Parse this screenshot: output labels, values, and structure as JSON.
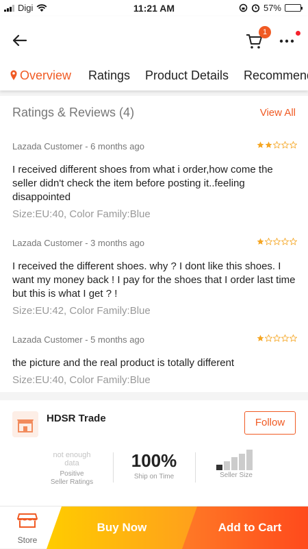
{
  "status_bar": {
    "carrier": "Digi",
    "time": "11:21 AM",
    "battery": "57%",
    "battery_level": 0.57
  },
  "header": {
    "cart_count": "1",
    "icons": [
      "back-arrow-icon",
      "cart-icon",
      "more-icon"
    ]
  },
  "tabs": [
    {
      "label": "Overview",
      "active": true
    },
    {
      "label": "Ratings",
      "active": false
    },
    {
      "label": "Product Details",
      "active": false
    },
    {
      "label": "Recommend",
      "active": false
    }
  ],
  "reviews_section": {
    "title": "Ratings & Reviews (4)",
    "view_all": "View All",
    "reviews": [
      {
        "meta": "Lazada Customer - 6 months ago",
        "rating": 2,
        "body": "I received different shoes from what i order,how come the seller didn't check the item before posting it..feeling disappointed",
        "sku": "Size:EU:40, Color Family:Blue"
      },
      {
        "meta": "Lazada Customer - 3 months ago",
        "rating": 1,
        "body": "I received the different shoes. why ? I dont like this shoes. I want my money back ! I pay for the shoes that I order last time but this is what I get ? !",
        "sku": "Size:EU:42, Color Family:Blue"
      },
      {
        "meta": "Lazada Customer - 5 months ago",
        "rating": 1,
        "body": "the picture and the real product is totally different",
        "sku": "Size:EU:40, Color Family:Blue"
      }
    ]
  },
  "store": {
    "name": "HDSR Trade",
    "follow": "Follow",
    "metrics": {
      "ratings_value_1": "not enough",
      "ratings_value_2": "data",
      "ratings_label_1": "Positive",
      "ratings_label_2": "Seller Ratings",
      "ship_value": "100%",
      "ship_label": "Ship on Time",
      "size_label": "Seller Size",
      "size_level": 1,
      "size_max": 5
    }
  },
  "bottom_bar": {
    "store_label": "Store",
    "buy_now": "Buy Now",
    "add_to_cart": "Add to Cart"
  },
  "colors": {
    "accent": "#f05a23",
    "star": "#f5a623",
    "buy_now": "#ffb80f",
    "add_cart": "#ff5a1f"
  }
}
